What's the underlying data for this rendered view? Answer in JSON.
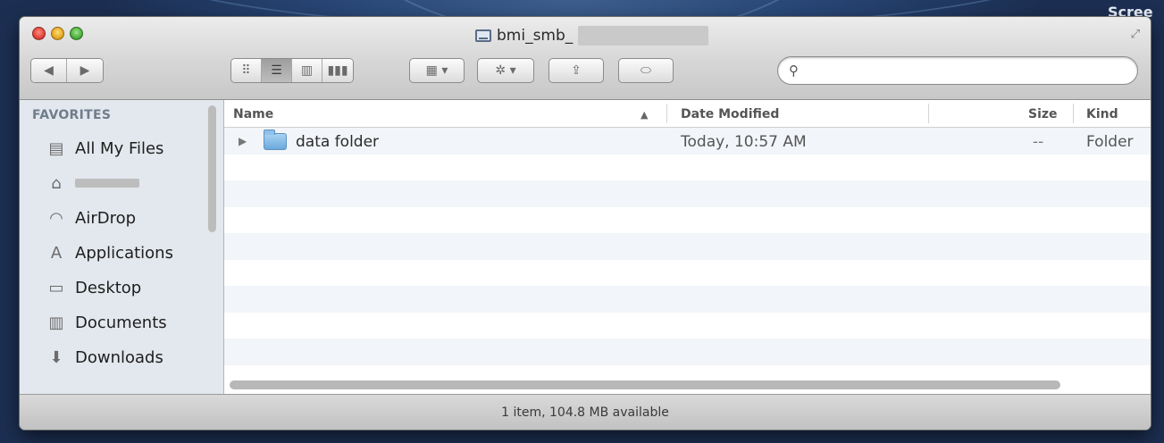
{
  "desktop": {
    "top_right_label": "Scree"
  },
  "window": {
    "title": "bmi_smb_",
    "toolbar": {
      "back_label": "◀",
      "forward_label": "▶",
      "view_icons": [
        "icon-view",
        "list-view",
        "column-view",
        "coverflow-view"
      ],
      "arrange_label": "▦ ▾",
      "action_label": "✲ ▾",
      "share_label": "⇪",
      "tags_label": "⬭",
      "search_placeholder": ""
    }
  },
  "sidebar": {
    "header": "FAVORITES",
    "items": [
      {
        "label": "All My Files",
        "icon": "all-files-icon",
        "glyph": "▤"
      },
      {
        "label": "",
        "icon": "home-icon",
        "glyph": "⌂",
        "redacted": true
      },
      {
        "label": "AirDrop",
        "icon": "airdrop-icon",
        "glyph": "◠"
      },
      {
        "label": "Applications",
        "icon": "applications-icon",
        "glyph": "A"
      },
      {
        "label": "Desktop",
        "icon": "desktop-icon",
        "glyph": "▭"
      },
      {
        "label": "Documents",
        "icon": "documents-icon",
        "glyph": "▥"
      },
      {
        "label": "Downloads",
        "icon": "downloads-icon",
        "glyph": "⬇"
      }
    ]
  },
  "table": {
    "columns": {
      "name": "Name",
      "sort_indicator": "▲",
      "date_modified": "Date Modified",
      "size": "Size",
      "kind": "Kind"
    },
    "rows": [
      {
        "name": "data folder",
        "date_modified": "Today, 10:57 AM",
        "size": "--",
        "kind": "Folder",
        "disclosure": "▶"
      }
    ]
  },
  "status": {
    "text": "1 item, 104.8 MB available"
  }
}
